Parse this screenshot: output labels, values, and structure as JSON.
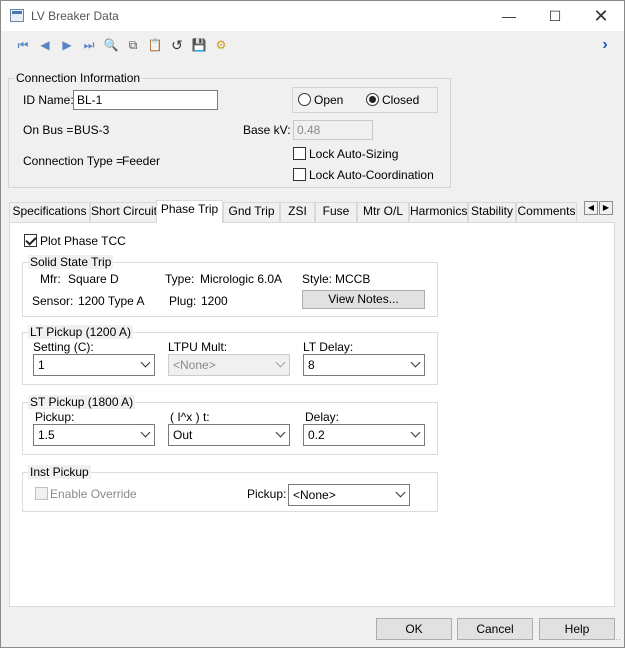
{
  "window": {
    "title": "LV Breaker Data"
  },
  "toolbar": {
    "icons": [
      "first-record-icon",
      "previous-record-icon",
      "next-record-icon",
      "last-record-icon",
      "find-icon",
      "copy-icon",
      "paste-icon",
      "undo-icon",
      "save-library-icon",
      "library-settings-icon",
      "expand-icon"
    ]
  },
  "connection": {
    "group_label": "Connection Information",
    "id_label": "ID Name:",
    "id_value": "BL-1",
    "open_label": "Open",
    "closed_label": "Closed",
    "state_selected": "Closed",
    "on_bus_label": "On Bus =",
    "on_bus_value": "BUS-3",
    "base_kv_label": "Base kV:",
    "base_kv_value": "0.48",
    "conn_type_label": "Connection Type =",
    "conn_type_value": "Feeder",
    "lock_auto_sizing": "Lock Auto-Sizing",
    "lock_auto_coord": "Lock Auto-Coordination"
  },
  "tabs": [
    "Specifications",
    "Short Circuit",
    "Phase Trip",
    "Gnd Trip",
    "ZSI",
    "Fuse",
    "Mtr O/L",
    "Harmonics",
    "Stability",
    "Comments"
  ],
  "active_tab": "Phase Trip",
  "phase_trip": {
    "plot_label": "Plot Phase TCC",
    "plot_checked": true,
    "sst": {
      "group_label": "Solid State Trip",
      "mfr_label": "Mfr:",
      "mfr_value": "Square D",
      "type_label": "Type:",
      "type_value": "Micrologic 6.0A",
      "style_label": "Style:",
      "style_value": "MCCB",
      "sensor_label": "Sensor:",
      "sensor_value": "1200 Type A",
      "plug_label": "Plug:",
      "plug_value": "1200",
      "view_notes": "View Notes..."
    },
    "lt": {
      "group_label": "LT Pickup (1200 A)",
      "setting_label": "Setting (C):",
      "setting_value": "1",
      "mult_label": "LTPU Mult:",
      "mult_value": "<None>",
      "delay_label": "LT Delay:",
      "delay_value": "8"
    },
    "st": {
      "group_label": "ST Pickup (1800 A)",
      "pickup_label": "Pickup:",
      "pickup_value": "1.5",
      "i2t_label": "( I^x ) t:",
      "i2t_value": "Out",
      "delay_label": "Delay:",
      "delay_value": "0.2"
    },
    "inst": {
      "group_label": "Inst Pickup",
      "override_label": "Enable Override",
      "pickup_label": "Pickup:",
      "pickup_value": "<None>"
    }
  },
  "buttons": {
    "ok": "OK",
    "cancel": "Cancel",
    "help": "Help"
  }
}
